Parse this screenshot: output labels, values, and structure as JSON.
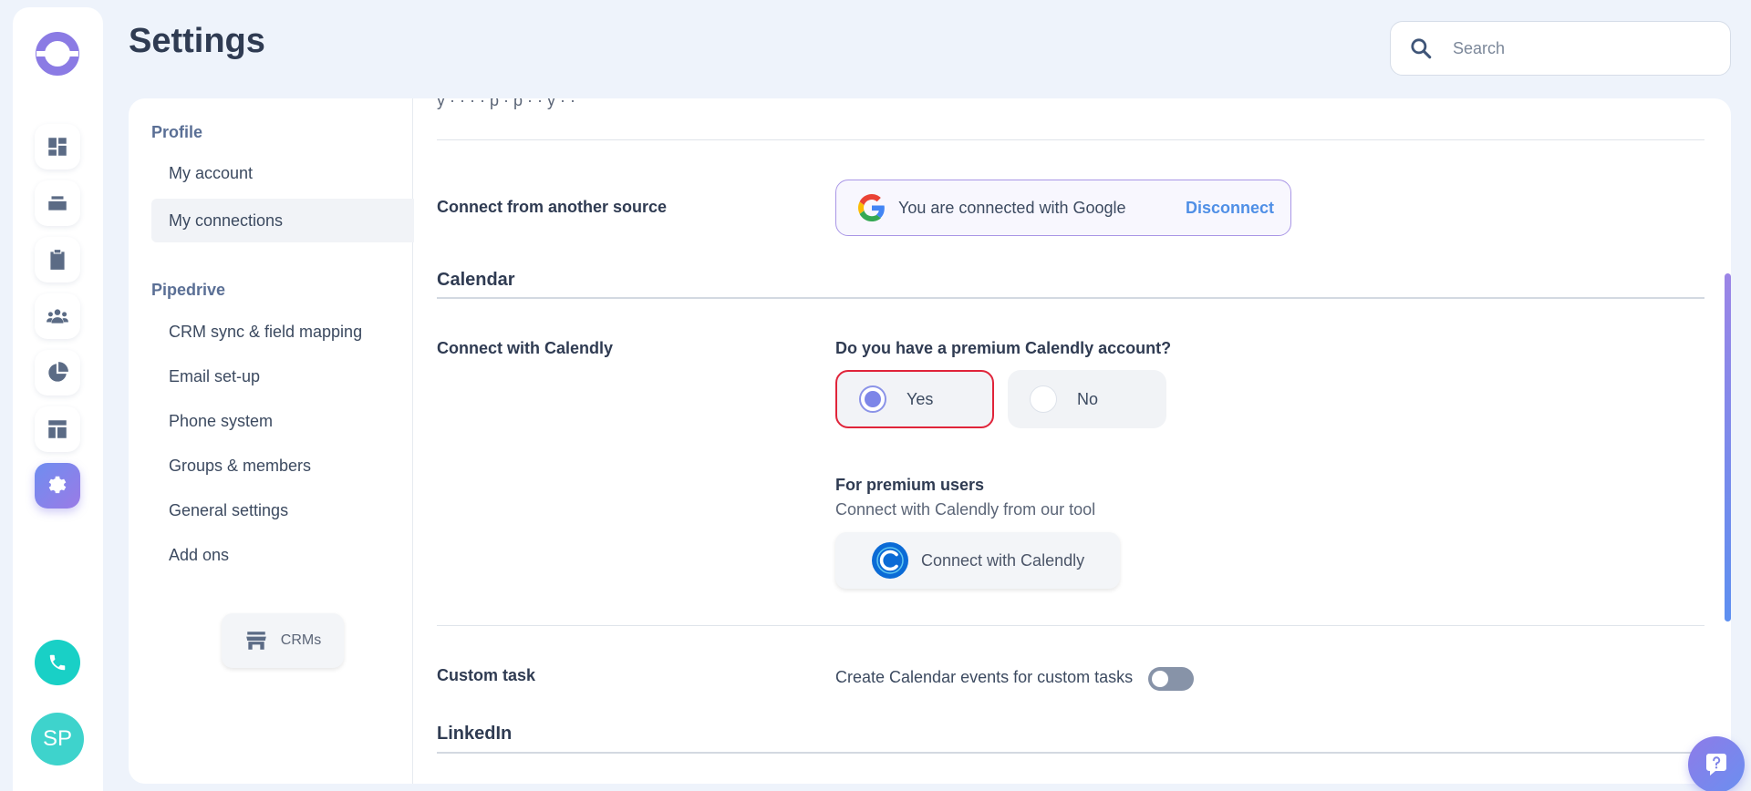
{
  "header": {
    "title": "Settings"
  },
  "search": {
    "placeholder": "Search"
  },
  "user": {
    "initials": "SP"
  },
  "subnav": {
    "profile_group": "Profile",
    "profile_items": [
      "My account",
      "My connections"
    ],
    "pipedrive_group": "Pipedrive",
    "pipedrive_items": [
      "CRM sync & field mapping",
      "Email set-up",
      "Phone system",
      "Groups & members",
      "General settings",
      "Add ons"
    ],
    "crms_button": "CRMs",
    "active_item": "My connections"
  },
  "connections": {
    "another_source_label": "Connect from another source",
    "google_status": "You are connected with Google",
    "disconnect_label": "Disconnect",
    "calendar_title": "Calendar",
    "calendly_label": "Connect with Calendly",
    "premium_question": "Do you have a premium Calendly account?",
    "options": [
      {
        "label": "Yes",
        "selected": true
      },
      {
        "label": "No",
        "selected": false
      }
    ],
    "premium_title": "For premium users",
    "premium_subtitle": "Connect with Calendly from our tool",
    "calendly_button": "Connect with Calendly",
    "custom_task_label": "Custom task",
    "custom_task_text": "Create Calendar events for custom tasks",
    "custom_task_enabled": false,
    "linkedin_title": "LinkedIn"
  },
  "colors": {
    "accent": "#7d86e8",
    "link": "#4f8fe6",
    "selected_border": "#e0243a",
    "phone": "#19d0c6",
    "avatar": "#3ed3cc"
  },
  "icons": {
    "rail": [
      "dashboard-icon",
      "layers-icon",
      "clipboard-icon",
      "team-icon",
      "pie-chart-icon",
      "layout-icon",
      "gear-icon"
    ],
    "phone": "phone-icon",
    "search": "search-icon",
    "help": "help-icon"
  }
}
